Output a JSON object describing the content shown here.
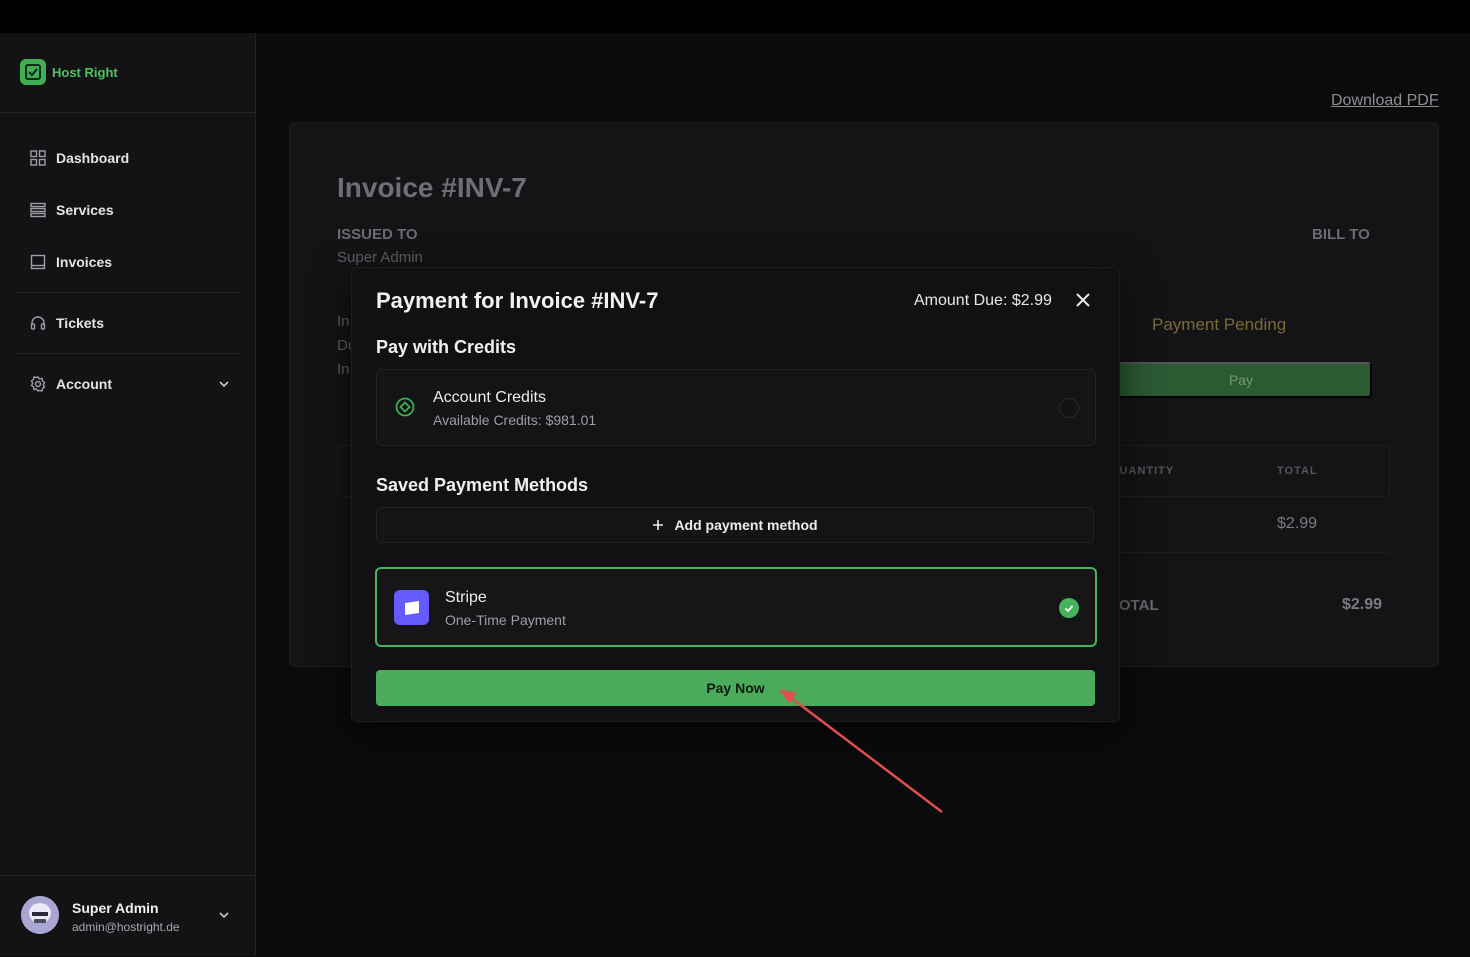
{
  "brand": {
    "name": "Host Right"
  },
  "sidebar": {
    "items": [
      {
        "label": "Dashboard",
        "icon": "grid-icon"
      },
      {
        "label": "Services",
        "icon": "server-icon"
      },
      {
        "label": "Invoices",
        "icon": "receipt-icon"
      },
      {
        "label": "Tickets",
        "icon": "headset-icon"
      },
      {
        "label": "Account",
        "icon": "gear-icon"
      }
    ]
  },
  "user": {
    "name": "Super Admin",
    "email": "admin@hostright.de"
  },
  "page": {
    "download_label": "Download PDF",
    "invoice_title": "Invoice #INV-7",
    "issued_to_label": "ISSUED TO",
    "issued_to_name": "Super Admin",
    "bill_to_label": "BILL TO",
    "fragments": [
      "In",
      "Du",
      "In"
    ],
    "status": "Payment Pending",
    "pay_label": "Pay",
    "table": {
      "col_quantity": "QUANTITY",
      "col_total": "TOTAL",
      "row_total": "$2.99",
      "grand_total_label": "TOTAL",
      "grand_total_value": "$2.99"
    }
  },
  "modal": {
    "title": "Payment for Invoice #INV-7",
    "amount_due": "Amount Due: $2.99",
    "credits_section": "Pay with Credits",
    "credits_title": "Account Credits",
    "credits_available": "Available Credits: $981.01",
    "saved_section": "Saved Payment Methods",
    "add_method_label": "Add payment method",
    "method_title": "Stripe",
    "method_sub": "One-Time Payment",
    "pay_now_label": "Pay Now"
  },
  "colors": {
    "accent": "#4caa5d",
    "stripe": "#635bff",
    "pending": "#7a6a3a"
  }
}
